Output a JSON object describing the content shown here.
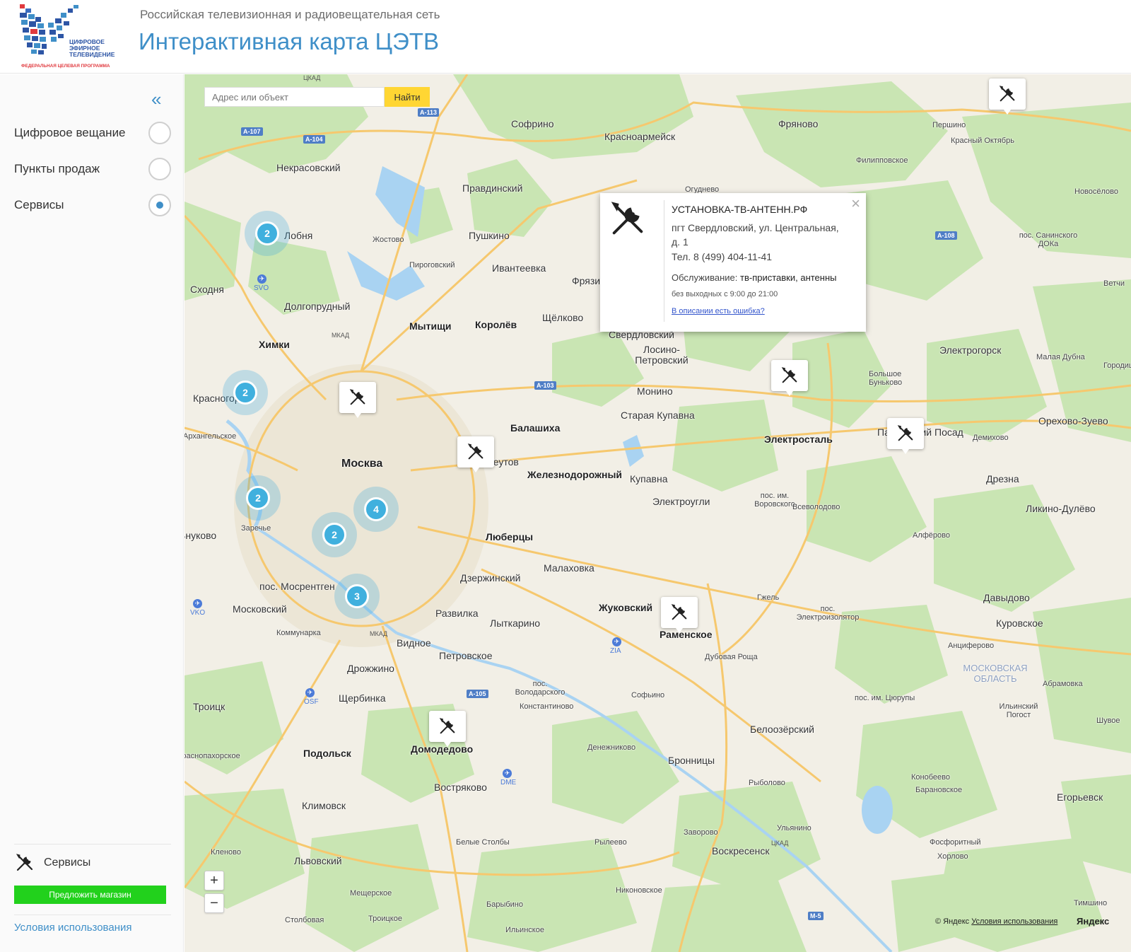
{
  "header": {
    "org_name": "Российская телевизионная и радиовещательная сеть",
    "app_title": "Интерактивная карта ЦЭТВ",
    "logo": {
      "line1": "ЦИФРОВОЕ",
      "line2": "ЭФИРНОЕ",
      "line3": "ТЕЛЕВИДЕНИЕ",
      "caption": "ФЕДЕРАЛЬНАЯ ЦЕЛЕВАЯ ПРОГРАММА"
    }
  },
  "sidebar": {
    "collapse_glyph": "«",
    "layers": [
      {
        "label": "Цифровое вещание",
        "selected": false
      },
      {
        "label": "Пункты продаж",
        "selected": false
      },
      {
        "label": "Сервисы",
        "selected": true
      }
    ],
    "legend_label": "Сервисы",
    "suggest_button": "Предложить магазин",
    "terms_link": "Условия использования"
  },
  "search": {
    "placeholder": "Адрес или объект",
    "button": "Найти"
  },
  "balloon": {
    "name": "УСТАНОВКА-ТВ-АНТЕНН.РФ",
    "address": "пгт Свердловский, ул. Центральная, д. 1",
    "phone": "Тел. 8 (499) 404-11-41",
    "service_label": "Обслуживание:",
    "service_value": "тв-приставки, антенны",
    "hours": "без выходных с 9:00 до 21:00",
    "error_link": "В описании есть ошибка?",
    "close_glyph": "×"
  },
  "clusters": [
    {
      "count": "2"
    },
    {
      "count": "2"
    },
    {
      "count": "2"
    },
    {
      "count": "4"
    },
    {
      "count": "2"
    },
    {
      "count": "3"
    }
  ],
  "zoom": {
    "in": "+",
    "out": "−"
  },
  "map_labels": {
    "capital": "Москва",
    "places": [
      "Софрино",
      "Фряново",
      "Красноармейск",
      "Першино",
      "Красный Октябрь",
      "Филипповское",
      "Некрасовский",
      "Правдинский",
      "Огуднево",
      "Новосёлово",
      "Лобня",
      "Жостово",
      "Пушкино",
      "пос. Санинского ДОКа",
      "Пироговский",
      "Ивантеевка",
      "Фрязино",
      "Ветчи",
      "Сходня",
      "Долгопрудный",
      "Мытищи",
      "Королёв",
      "Щёлково",
      "Химки",
      "Свердловский",
      "Лосино-Петровский",
      "Электрогорск",
      "Малая Дубна",
      "Городищи",
      "Красногорск",
      "Электросталь",
      "Монино",
      "Большое Буньково",
      "Архангельское",
      "Балашиха",
      "Старая Купавна",
      "Павловский Посад",
      "Орехово-Зуево",
      "Демихово",
      "Реутов",
      "Железнодорожный",
      "Купавна",
      "Дрезна",
      "пос. им. Воровского",
      "Всеволодово",
      "Электроугли",
      "Ликино-Дулёво",
      "Внуково",
      "Заречье",
      "Люберцы",
      "Алфёрово",
      "Малаховка",
      "Дзержинский",
      "пос. Мосрентген",
      "Московский",
      "Жуковский",
      "Гжель",
      "пос. Электроизолятор",
      "Давыдово",
      "Развилка",
      "Лыткарино",
      "Коммунарка",
      "Раменское",
      "Куровское",
      "Видное",
      "Петровское",
      "Дубовая Роща",
      "Анциферово",
      "Дрожжино",
      "пос. Володарского",
      "Абрамовка",
      "Троицк",
      "Щербинка",
      "Константиново",
      "Софьино",
      "пос. им. Цюрупы",
      "Ильинский Погост",
      "Белоозёрский",
      "Домодедово",
      "Денежниково",
      "Краснопахорское",
      "Подольск",
      "Бронницы",
      "Рыболово",
      "Конобеево",
      "Востряково",
      "Климовск",
      "Барановское",
      "Егорьевск",
      "Ульянино",
      "Заворово",
      "Белые Столбы",
      "Рылеево",
      "Воскресенск",
      "Фосфоритный",
      "Кленово",
      "Львовский",
      "Хорлово",
      "Никоновское",
      "Мещерское",
      "Барыбино",
      "Тимшино",
      "Столбовая",
      "Троицкое",
      "Ильинское",
      "Шувое"
    ],
    "region": "МОСКОВСКАЯ ОБЛАСТЬ",
    "roads": [
      "А-113",
      "А-107",
      "А-104",
      "А-108",
      "А-103",
      "А-105",
      "М-5",
      "ЦКАД",
      "МКАД"
    ],
    "airports": [
      "SVO",
      "VKO",
      "OSF",
      "ZIA",
      "DME"
    ]
  },
  "copyright": {
    "prefix": "© Яндекс",
    "terms": "Условия использования",
    "brand": "Яндекс"
  },
  "colors": {
    "accent": "#3f8fc8",
    "suggest_button": "#22d11c",
    "search_button": "#ffd633",
    "cluster": "#40b0de",
    "map_bg": "#f2efe6",
    "forest": "#c9e5b3",
    "water": "#a9d3f2",
    "road_major": "#f6c86e"
  }
}
